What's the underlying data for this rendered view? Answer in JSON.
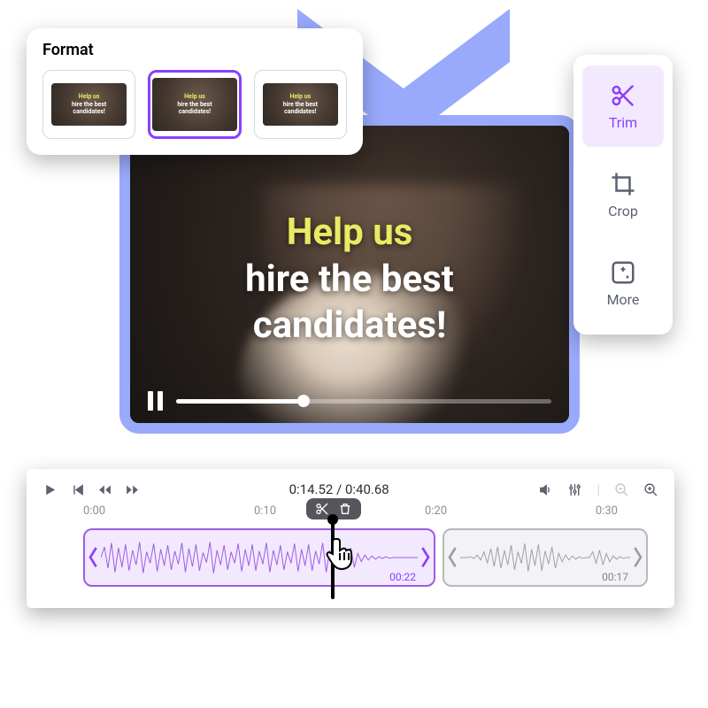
{
  "format": {
    "title": "Format",
    "thumb_line1": "Help us",
    "thumb_line2": "hire the best",
    "thumb_line3": "candidates!"
  },
  "video": {
    "line1": "Help us",
    "line2": "hire the best",
    "line3": "candidates!",
    "progress_pct": 34
  },
  "tools": {
    "trim": "Trim",
    "crop": "Crop",
    "more": "More"
  },
  "timeline": {
    "current_time": "0:14.52",
    "total_time": "0:40.68",
    "ticks": [
      "0:00",
      "0:10",
      "0:20",
      "0:30"
    ],
    "clip1_duration": "00:22",
    "clip2_duration": "00:17"
  }
}
